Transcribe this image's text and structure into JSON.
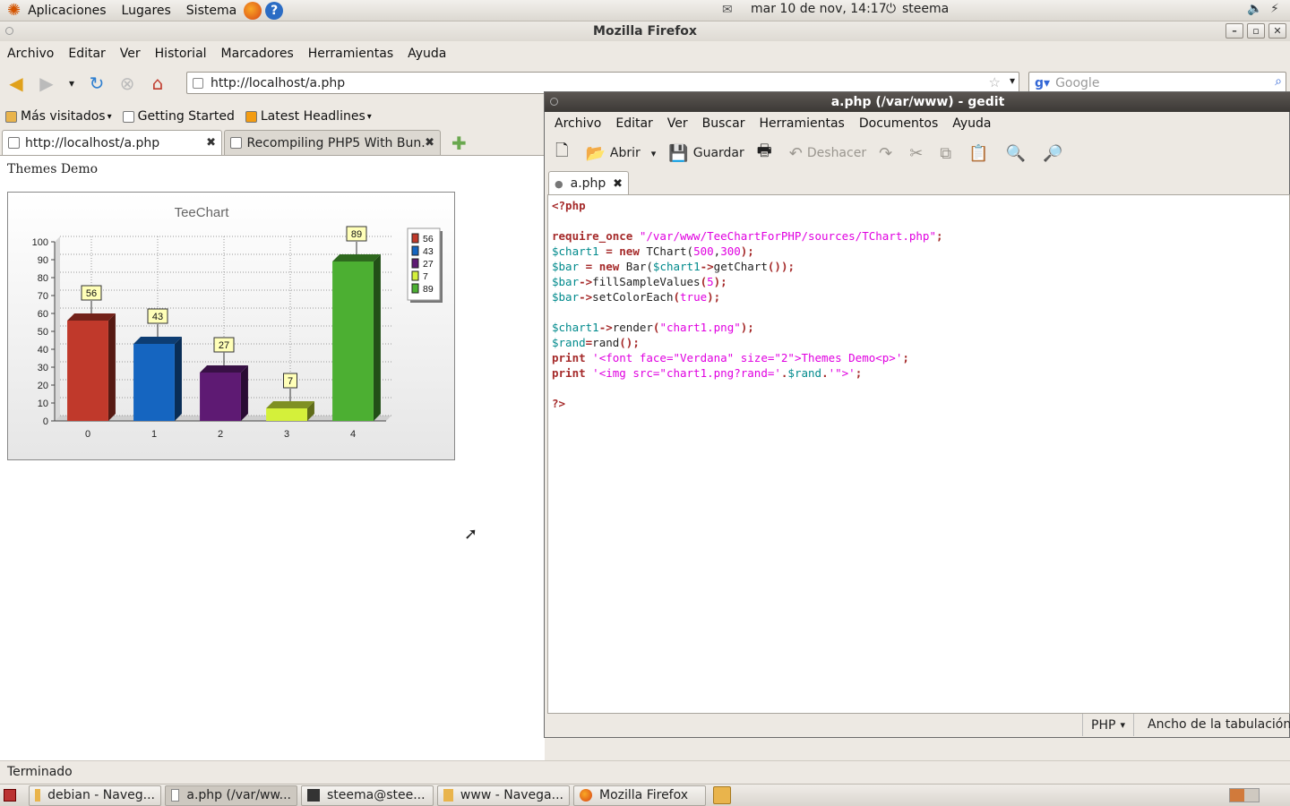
{
  "top_panel": {
    "menus": [
      "Aplicaciones",
      "Lugares",
      "Sistema"
    ],
    "datetime": "mar 10 de nov, 14:17",
    "user": "steema"
  },
  "firefox": {
    "window_title": "Mozilla Firefox",
    "menu": [
      "Archivo",
      "Editar",
      "Ver",
      "Historial",
      "Marcadores",
      "Herramientas",
      "Ayuda"
    ],
    "url": "http://localhost/a.php",
    "search_placeholder": "Google",
    "bookmarks": [
      "Más visitados",
      "Getting Started",
      "Latest Headlines"
    ],
    "tabs": [
      {
        "label": "http://localhost/a.php"
      },
      {
        "label": "Recompiling PHP5 With Bun..."
      }
    ],
    "page_text": "Themes Demo",
    "status": "Terminado"
  },
  "chart_data": {
    "type": "bar",
    "title": "TeeChart",
    "categories": [
      "0",
      "1",
      "2",
      "3",
      "4"
    ],
    "values": [
      56,
      43,
      27,
      7,
      89
    ],
    "colors": [
      "#c0392b",
      "#1565c0",
      "#5e1a73",
      "#d4f03a",
      "#4caf32"
    ],
    "yticks": [
      0,
      10,
      20,
      30,
      40,
      50,
      60,
      70,
      80,
      90,
      100
    ],
    "ylim": [
      0,
      100
    ],
    "legend": [
      "56",
      "43",
      "27",
      "7",
      "89"
    ],
    "legend_position": "right",
    "grid": true
  },
  "gedit": {
    "window_title": "a.php (/var/www) - gedit",
    "menu": [
      "Archivo",
      "Editar",
      "Ver",
      "Buscar",
      "Herramientas",
      "Documentos",
      "Ayuda"
    ],
    "toolbar": {
      "open": "Abrir",
      "save": "Guardar",
      "undo": "Deshacer"
    },
    "tab": "a.php",
    "lang": "PHP",
    "tabwidth": "Ancho de la tabulación:"
  },
  "code_lines": [
    [
      [
        "kw",
        "<?php"
      ]
    ],
    [
      [
        "plain",
        ""
      ]
    ],
    [
      [
        "kw",
        "require_once"
      ],
      [
        "plain",
        " "
      ],
      [
        "str",
        "\"/var/www/TeeChartForPHP/sources/TChart.php\""
      ],
      [
        "kw",
        ";"
      ]
    ],
    [
      [
        "var",
        "$chart1"
      ],
      [
        "plain",
        " "
      ],
      [
        "kw",
        "= new"
      ],
      [
        "plain",
        " TChart("
      ],
      [
        "num",
        "500"
      ],
      [
        "plain",
        ","
      ],
      [
        "num",
        "300"
      ],
      [
        "kw",
        ");"
      ]
    ],
    [
      [
        "var",
        "$bar"
      ],
      [
        "plain",
        " "
      ],
      [
        "kw",
        "= new"
      ],
      [
        "plain",
        " Bar("
      ],
      [
        "var",
        "$chart1"
      ],
      [
        "kw",
        "->"
      ],
      [
        "plain",
        "getChart"
      ],
      [
        "kw",
        "());"
      ]
    ],
    [
      [
        "var",
        "$bar"
      ],
      [
        "kw",
        "->"
      ],
      [
        "plain",
        "fillSampleValues"
      ],
      [
        "kw",
        "("
      ],
      [
        "num",
        "5"
      ],
      [
        "kw",
        ");"
      ]
    ],
    [
      [
        "var",
        "$bar"
      ],
      [
        "kw",
        "->"
      ],
      [
        "plain",
        "setColorEach"
      ],
      [
        "kw",
        "("
      ],
      [
        "num",
        "true"
      ],
      [
        "kw",
        ");"
      ]
    ],
    [
      [
        "plain",
        ""
      ]
    ],
    [
      [
        "var",
        "$chart1"
      ],
      [
        "kw",
        "->"
      ],
      [
        "plain",
        "render"
      ],
      [
        "kw",
        "("
      ],
      [
        "str",
        "\"chart1.png\""
      ],
      [
        "kw",
        ");"
      ]
    ],
    [
      [
        "var",
        "$rand"
      ],
      [
        "kw",
        "="
      ],
      [
        "plain",
        "rand"
      ],
      [
        "kw",
        "();"
      ]
    ],
    [
      [
        "kw",
        "print"
      ],
      [
        "plain",
        " "
      ],
      [
        "str",
        "'<font face=\"Verdana\" size=\"2\">Themes Demo<p>'"
      ],
      [
        "kw",
        ";"
      ]
    ],
    [
      [
        "kw",
        "print"
      ],
      [
        "plain",
        " "
      ],
      [
        "str",
        "'<img src=\"chart1.png?rand='"
      ],
      [
        "kw",
        "."
      ],
      [
        "var",
        "$rand"
      ],
      [
        "kw",
        "."
      ],
      [
        "str",
        "'\">'"
      ],
      [
        "kw",
        ";"
      ]
    ],
    [
      [
        "plain",
        ""
      ]
    ],
    [
      [
        "kw",
        "?>"
      ]
    ]
  ],
  "taskbar": [
    "debian - Naveg...",
    "a.php (/var/ww...",
    "steema@stee...",
    "www - Navega...",
    "Mozilla Firefox"
  ]
}
